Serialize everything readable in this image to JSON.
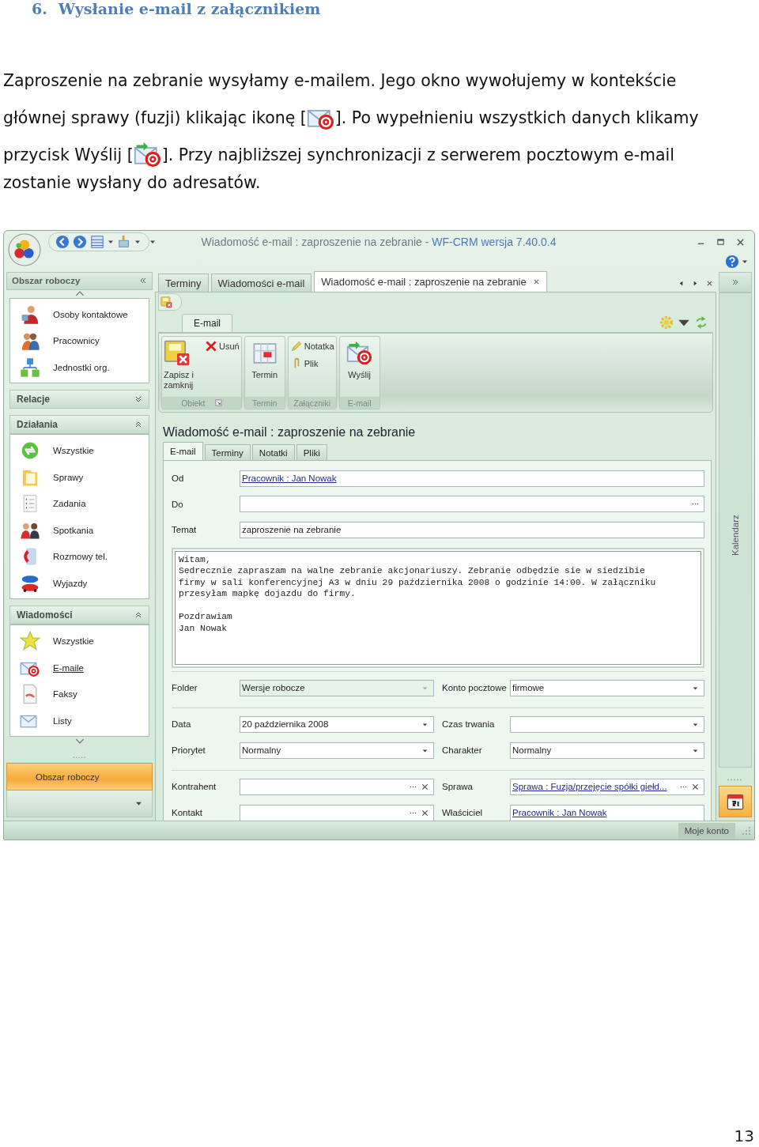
{
  "heading": {
    "number": "6.",
    "title": "Wysłanie e-mail z załącznikiem"
  },
  "intro": [
    [
      {
        "kind": "text",
        "text": "Zaproszenie na zebranie wysyłamy e-mailem. Jego okno wywołujemy  w kontekście"
      }
    ],
    [
      {
        "kind": "text",
        "text": "głównej sprawy (fuzji) klikając ikonę ["
      },
      {
        "kind": "icon"
      },
      {
        "kind": "text",
        "text": "]. Po wypełnieniu wszystkich danych klikamy"
      }
    ],
    [
      {
        "kind": "text",
        "text": "przycisk Wyślij ["
      },
      {
        "kind": "icon"
      },
      {
        "kind": "text",
        "text": "]. Przy najbliższej synchronizacji z serwerem pocztowym e-mail"
      }
    ],
    [
      {
        "kind": "text",
        "text": "zostanie wysłany do adresatów."
      }
    ]
  ],
  "window": {
    "title": "Wiadomość e-mail : zaproszenie na zebranie -",
    "app_name": "WF-CRM wersja 7.40.0.4"
  },
  "sidebar": {
    "title": "Obszar roboczy",
    "groups": [
      {
        "items": [
          {
            "label": "Osoby kontaktowe",
            "selected": false
          },
          {
            "label": "Pracownicy",
            "selected": false
          },
          {
            "label": "Jednostki org.",
            "selected": false
          }
        ]
      },
      {
        "title": "Relacje",
        "expanded": false
      },
      {
        "title": "Działania",
        "expanded": true,
        "items": [
          {
            "label": "Wszystkie",
            "selected": false
          },
          {
            "label": "Sprawy",
            "selected": false
          },
          {
            "label": "Zadania",
            "selected": false
          },
          {
            "label": "Spotkania",
            "selected": false
          },
          {
            "label": "Rozmowy tel.",
            "selected": false
          },
          {
            "label": "Wyjazdy",
            "selected": false
          }
        ]
      },
      {
        "title": "Wiadomości",
        "expanded": true,
        "items": [
          {
            "label": "Wszystkie",
            "selected": false
          },
          {
            "label": "E-maile",
            "selected": true
          },
          {
            "label": "Faksy",
            "selected": false
          },
          {
            "label": "Listy",
            "selected": false
          }
        ]
      }
    ],
    "nav_buttons": [
      {
        "label": "Obszar roboczy",
        "selected": true
      }
    ]
  },
  "doc_tabs": [
    {
      "label": "Terminy",
      "selected": false,
      "closable": false
    },
    {
      "label": "Wiadomości e-mail",
      "selected": false,
      "closable": false
    },
    {
      "label": "Wiadomość e-mail : zaproszenie na zebranie",
      "selected": true,
      "closable": true
    }
  ],
  "ribbon": {
    "tabs": [
      {
        "label": "E-mail",
        "selected": true
      }
    ],
    "groups": [
      {
        "label": "Obiekt",
        "launcher": true,
        "buttons": [
          {
            "label": "Zapisz i zamknij",
            "kind": "large"
          },
          {
            "label": "Usuń",
            "kind": "small"
          }
        ]
      },
      {
        "label": "Termin",
        "launcher": false,
        "buttons": [
          {
            "label": "Termin",
            "kind": "large"
          }
        ]
      },
      {
        "label": "Załączniki",
        "launcher": false,
        "buttons": [
          {
            "label": "Notatka",
            "kind": "small"
          },
          {
            "label": "Plik",
            "kind": "small"
          }
        ]
      },
      {
        "label": "E-mail",
        "launcher": false,
        "buttons": [
          {
            "label": "Wyślij",
            "kind": "large"
          }
        ]
      }
    ]
  },
  "form": {
    "title": "Wiadomość e-mail : zaproszenie na zebranie",
    "tabs": [
      {
        "label": "E-mail",
        "selected": true
      },
      {
        "label": "Terminy",
        "selected": false
      },
      {
        "label": "Notatki",
        "selected": false
      },
      {
        "label": "Pliki",
        "selected": false
      }
    ],
    "fields": [
      {
        "label": "Od",
        "kind": "text",
        "value": "Pracownik : Jan Nowak",
        "link": true
      },
      {
        "label": "Do",
        "kind": "picker"
      },
      {
        "label": "Temat",
        "kind": "text",
        "value": "zaproszenie na zebranie",
        "link": false
      }
    ],
    "body": [
      [
        "Witam,",
        "Sedrecznie zapraszam na walne zebranie akcjonariuszy. Zebranie odbędzie sie w siedzibie",
        "firmy w sali konferencyjnej A3 w dniu 29 października 2008 o godzinie 14:00. W załączniku",
        "przesyłam mapkę dojazdu do firmy."
      ],
      [
        "Pozdrawiam",
        "Jan Nowak"
      ]
    ],
    "sections": [
      [
        {
          "label": "Folder",
          "kind": "dropdown",
          "value": "Wersje robocze",
          "link": false,
          "readonly": true
        },
        {
          "label": "Konto pocztowe",
          "kind": "dropdown",
          "value": "firmowe",
          "link": false,
          "readonly": false
        }
      ],
      [
        {
          "label": "Data",
          "kind": "dropdown",
          "value": "20 października 2008",
          "link": false,
          "readonly": false
        },
        {
          "label": "Czas trwania",
          "kind": "dropdown",
          "readonly": false
        },
        {
          "label": "Priorytet",
          "kind": "dropdown",
          "value": "Normalny",
          "link": false,
          "readonly": false
        },
        {
          "label": "Charakter",
          "kind": "dropdown",
          "value": "Normalny",
          "link": false,
          "readonly": false
        }
      ],
      [
        {
          "label": "Kontrahent",
          "kind": "lookup",
          "readonly": false
        },
        {
          "label": "Sprawa",
          "kind": "lookup",
          "value": "Sprawa : Fuzja/przejęcie spółki giełd...",
          "link": true,
          "readonly": false
        },
        {
          "label": "Kontakt",
          "kind": "lookup",
          "readonly": false
        },
        {
          "label": "Właściciel",
          "kind": "text",
          "value": "Pracownik : Jan Nowak",
          "link": true,
          "readonly": false
        }
      ]
    ]
  },
  "side_panel": {
    "title": "Kalendarz"
  },
  "status_bar": {
    "text": "Moje konto"
  },
  "page_number": "13"
}
